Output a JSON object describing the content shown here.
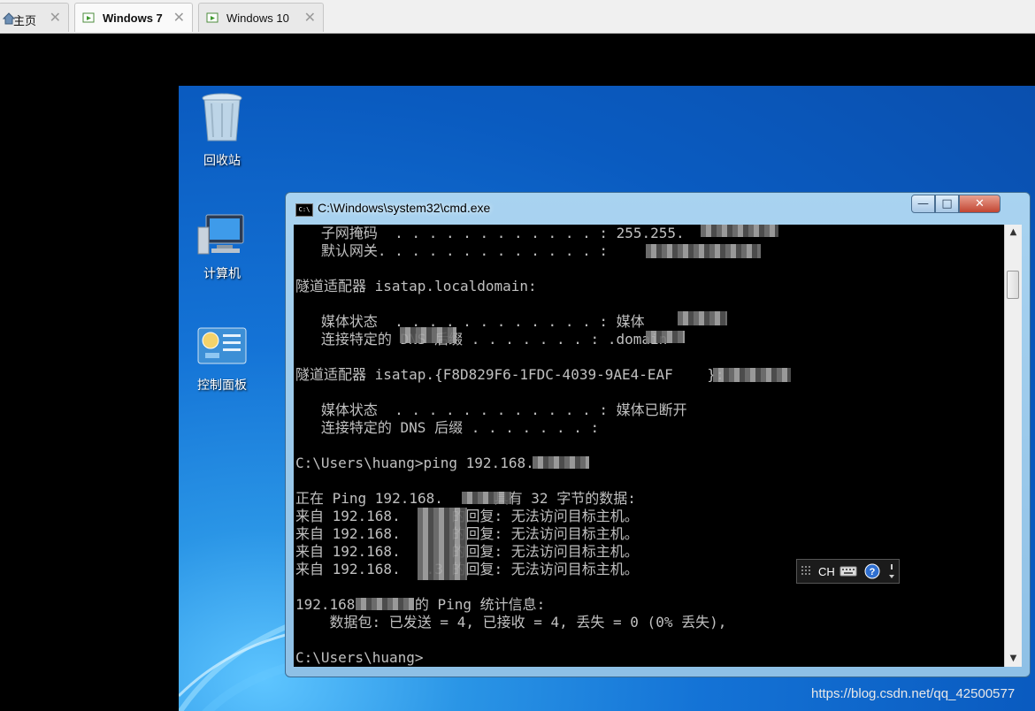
{
  "tabs": [
    {
      "label": "主页"
    },
    {
      "label": "Windows 7"
    },
    {
      "label": "Windows 10"
    }
  ],
  "tab_close_glyph": "✕",
  "desktop": {
    "icons": [
      {
        "label": "回收站",
        "icon": "recycle-bin-icon"
      },
      {
        "label": "计算机",
        "icon": "computer-icon"
      },
      {
        "label": "控制面板",
        "icon": "control-panel-icon"
      }
    ]
  },
  "cmd": {
    "title": "C:\\Windows\\system32\\cmd.exe",
    "icon_text": "C:\\",
    "lines": [
      "   子网掩码  . . . . . . . . . . . . : 255.255.",
      "   默认网关. . . . . . . . . . . . . :",
      "",
      "隧道适配器 isatap.localdomain:",
      "",
      "   媒体状态  . . . . . . . . . . . . : 媒体",
      "   连接特定的 DNS 后缀 . . . . . . . : .domain",
      "",
      "隧道适配器 isatap.{F8D829F6-1FDC-4039-9AE4-EAF    }:",
      "",
      "   媒体状态  . . . . . . . . . . . . : 媒体已断开",
      "   连接特定的 DNS 后缀 . . . . . . . :",
      "",
      "C:\\Users\\huang>ping 192.168.",
      "",
      "正在 Ping 192.168.      具有 32 字节的数据:",
      "来自 192.168.      的回复: 无法访问目标主机。",
      "来自 192.168.      的回复: 无法访问目标主机。",
      "来自 192.168.      的回复: 无法访问目标主机。",
      "来自 192.168.   .3 的回复: 无法访问目标主机。",
      "",
      "192.168       的 Ping 统计信息:",
      "    数据包: 已发送 = 4, 已接收 = 4, 丢失 = 0 (0% 丢失),",
      "",
      "C:\\Users\\huang>"
    ]
  },
  "window_buttons": {
    "minimize": "—",
    "maximize": "□",
    "close": "✕"
  },
  "scroll_arrows": {
    "up": "▲",
    "down": "▼"
  },
  "langbar": {
    "text": "CH"
  },
  "watermark": "https://blog.csdn.net/qq_42500577"
}
